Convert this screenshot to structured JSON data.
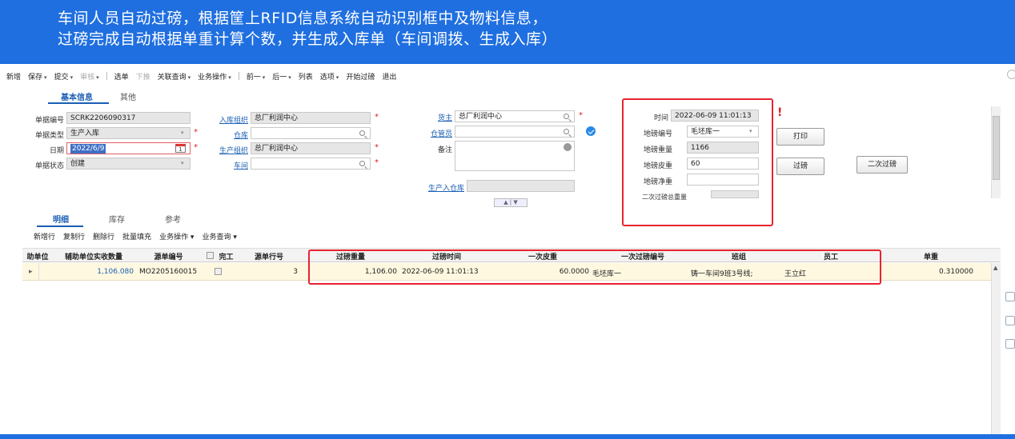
{
  "banner": {
    "line1": "车间人员自动过磅，根据筐上RFID信息系统自动识别框中及物料信息，",
    "line2": "过磅完成自动根据单重计算个数，并生成入库单（车间调拨、生成入库）"
  },
  "toolbar": {
    "new": "新增",
    "save": "保存",
    "submit": "提交",
    "audit": "审核",
    "select_order": "选单",
    "push_down": "下推",
    "related_query": "关联查询",
    "biz_ops": "业务操作",
    "prev": "前一",
    "next": "后一",
    "list": "列表",
    "options": "选项",
    "start_weigh": "开始过磅",
    "exit": "退出"
  },
  "tabs": {
    "basic": "基本信息",
    "other": "其他",
    "detail": "明细",
    "stock": "库存",
    "ref": "参考"
  },
  "form": {
    "doc_no_label": "单据编号",
    "doc_no": "SCRK2206090317",
    "doc_type_label": "单据类型",
    "doc_type": "生产入库",
    "date_label": "日期",
    "date": "2022/6/9",
    "date_badge": "1",
    "status_label": "单据状态",
    "status": "创建",
    "in_org_label": "入库组织",
    "in_org": "总厂利润中心",
    "warehouse_label": "仓库",
    "warehouse": "",
    "prod_org_label": "生产组织",
    "prod_org": "总厂利润中心",
    "workshop_label": "车间",
    "workshop": "",
    "owner_label": "货主",
    "owner": "总厂利润中心",
    "keeper_label": "仓管员",
    "keeper": "",
    "remark_label": "备注",
    "prod_in_wh_label": "生产入仓库",
    "prod_in_wh": "",
    "time_label": "时间",
    "time": "2022-06-09 11:01:13",
    "scale_no_label": "地磅编号",
    "scale_no": "毛坯库一",
    "scale_weight_label": "地磅重量",
    "scale_weight": "1166",
    "scale_tare_label": "地磅皮重",
    "scale_tare": "60",
    "scale_net_label": "地磅净重",
    "scale_net": "",
    "second_total_label": "二次过磅总重量",
    "second_total": "",
    "print_btn": "打印",
    "weigh_btn": "过磅",
    "second_weigh_btn": "二次过磅",
    "updown": "▲ | ▼"
  },
  "grid": {
    "toolbar": [
      "新增行",
      "复制行",
      "删除行",
      "批量填充",
      "业务操作 ▾",
      "业务查询 ▾"
    ],
    "headers": {
      "aux_unit": "助单位",
      "aux_qty": "辅助单位实收数量",
      "src_no": "源单编号",
      "done": "完工",
      "src_line": "源单行号",
      "weigh_weight": "过磅重量",
      "weigh_time": "过磅时间",
      "tare_once": "一次皮重",
      "weigh_no_once": "一次过磅编号",
      "team": "班组",
      "employee": "员工",
      "unit_weight": "单重"
    },
    "row": {
      "aux_qty": "1,106.080",
      "src_no": "MO2205160015",
      "src_line": "3",
      "weigh_weight": "1,106.00",
      "weigh_time": "2022-06-09 11:01:13",
      "tare_once": "60.0000",
      "weigh_no_once": "毛坯库一",
      "team": "铸一车间9班3号线;",
      "employee": "王立红",
      "unit_weight": "0.310000"
    }
  },
  "colors": {
    "banner": "#1f6fe0",
    "highlight": "#e8232f",
    "link": "#1a5fb4"
  }
}
